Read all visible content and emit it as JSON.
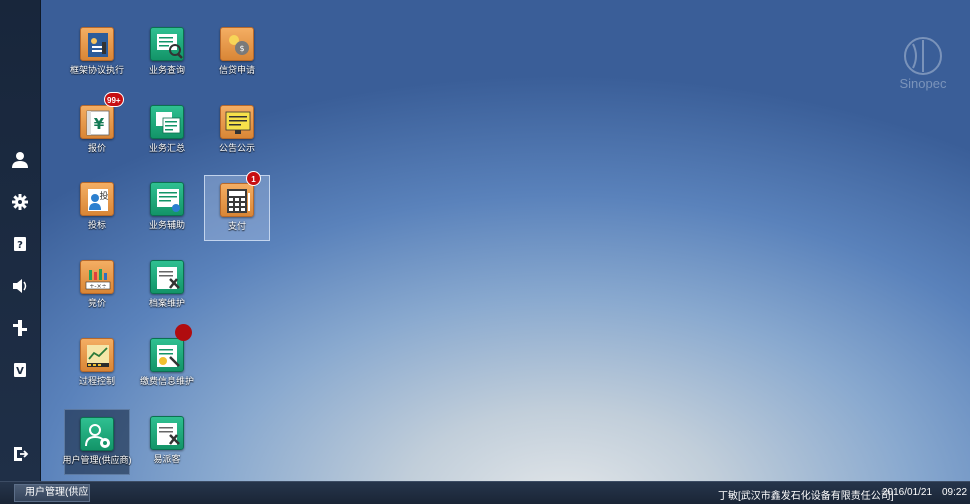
{
  "desktop": {
    "icons": [
      {
        "label": "框架协议执行"
      },
      {
        "label": "业务查询"
      },
      {
        "label": "信贷申请"
      },
      {
        "label": "报价",
        "badge": "99+"
      },
      {
        "label": "业务汇总"
      },
      {
        "label": "公告公示"
      },
      {
        "label": "投标"
      },
      {
        "label": "业务辅助"
      },
      {
        "label": "支付",
        "badge": "1"
      },
      {
        "label": "竞价"
      },
      {
        "label": "档案维护"
      },
      {
        "label": "过程控制"
      },
      {
        "label": "缴费信息维护"
      },
      {
        "label": "用户管理(供应商)"
      },
      {
        "label": "易派客"
      }
    ],
    "logo_text": "Sinopec"
  },
  "sidebar": {
    "items": [
      {
        "icon": "user-icon"
      },
      {
        "icon": "gear-icon"
      },
      {
        "icon": "help-icon"
      },
      {
        "icon": "speaker-icon"
      },
      {
        "icon": "network-icon"
      },
      {
        "icon": "version-icon"
      },
      {
        "icon": "logout-icon"
      }
    ]
  },
  "taskbar": {
    "task_label": "用户管理(供应",
    "user": "丁敏[武汉市鑫发石化设备有限责任公司]",
    "date": "2016/01/21",
    "time": "09:22"
  },
  "colors": {
    "orange_icon": "#e89a4c",
    "teal_icon": "#1fa87a",
    "badge": "#c70f12",
    "sidebar": "#1b2a40"
  }
}
